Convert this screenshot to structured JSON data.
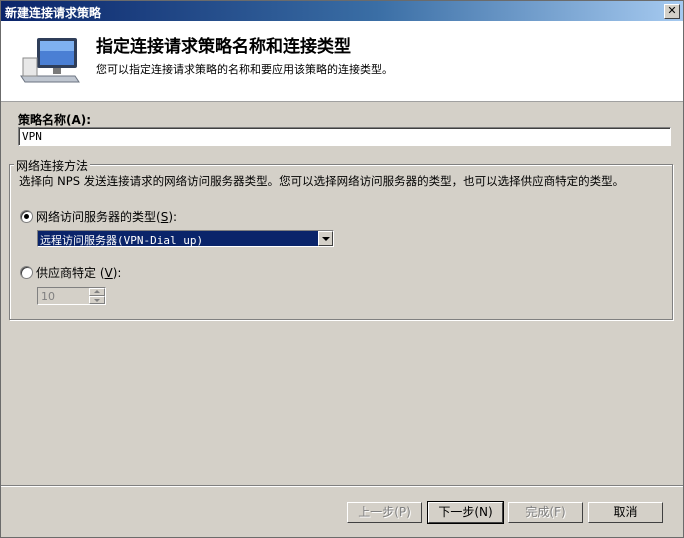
{
  "window": {
    "title": "新建连接请求策略"
  },
  "header": {
    "title": "指定连接请求策略名称和连接类型",
    "subtitle": "您可以指定连接请求策略的名称和要应用该策略的连接类型。"
  },
  "policy_name": {
    "label": "策略名称",
    "accel": "(A)",
    "accel_letter": "A",
    "value": "VPN"
  },
  "group": {
    "legend": "网络连接方法",
    "description": "选择向 NPS 发送连接请求的网络访问服务器类型。您可以选择网络访问服务器的类型，也可以选择供应商特定的类型。",
    "nas_type": {
      "label": "网络访问服务器的类型",
      "accel": "S",
      "selected": true,
      "dropdown_value": "远程访问服务器(VPN-Dial up)"
    },
    "vendor_specific": {
      "label": "供应商特定",
      "accel": "V",
      "selected": false,
      "value": "10"
    }
  },
  "buttons": {
    "back": "上一步(P)",
    "next": "下一步(N)",
    "finish": "完成(F)",
    "cancel": "取消"
  }
}
